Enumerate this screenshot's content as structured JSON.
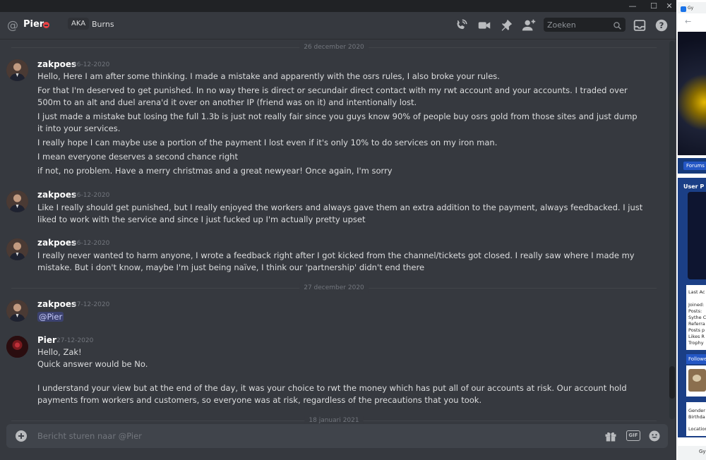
{
  "window": {
    "minimize": "—",
    "maximize": "☐",
    "close": "✕"
  },
  "header": {
    "at_symbol": "@",
    "dm_name": "Pier",
    "aka_label": "AKA",
    "alias": "Burns",
    "search_placeholder": "Zoeken"
  },
  "dividers": {
    "d1": "26 december 2020",
    "d2": "27 december 2020",
    "d3": "18 januari 2021"
  },
  "messages": [
    {
      "author": "zakpoes",
      "timestamp": "26-12-2020",
      "lines": [
        "Hello, Here I am after some thinking. I made a mistake and apparently with the osrs rules, I also broke your rules.",
        "For that I'm deserved to get punished. In no way there is direct or secundair direct contact with my rwt account and your accounts. I traded over 500m to an alt and duel arena'd it over on another IP (friend was on it) and intentionally lost.",
        "I just made a mistake but losing the full 1.3b is just not really fair since you guys know 90% of people buy osrs gold from those sites and just dump it into your services.",
        "I really hope I can maybe use a portion of the payment I lost even if it's only 10% to do services on my iron man.",
        "I mean everyone deserves a second chance right",
        "if not, no problem. Have a merry christmas and a great newyear! Once again, I'm sorry"
      ]
    },
    {
      "author": "zakpoes",
      "timestamp": "26-12-2020",
      "lines": [
        "Like I really should get punished, but I really enjoyed the workers and always gave them an extra addition to the payment, always feedbacked. I just liked to work with the service and since I just fucked up I'm actually pretty upset"
      ]
    },
    {
      "author": "zakpoes",
      "timestamp": "26-12-2020",
      "lines": [
        "I really never wanted to harm anyone, I wrote a feedback right after I got kicked from the channel/tickets got closed. I really saw where I made my mistake. But i don't know, maybe I'm just being naïve, I think our 'partnership' didn't end there"
      ]
    },
    {
      "author": "zakpoes",
      "timestamp": "27-12-2020",
      "lines": [
        "@Pier"
      ]
    },
    {
      "author": "Pier",
      "timestamp": "27-12-2020",
      "lines": [
        "Hello, Zak!",
        "Quick answer would be No.",
        "I understand your view but at the end of the day, it was your choice to rwt the money which has put all of our accounts at risk. Our account hold payments from workers and customers, so everyone was at risk, regardless of the precautions that you took."
      ]
    }
  ],
  "composer": {
    "placeholder": "Bericht sturen naar @Pier",
    "gif_label": "GIF"
  },
  "browser": {
    "tab_label": "Gy",
    "nav_button": "Forums",
    "panel_title": "User P",
    "info": [
      "Last Ac",
      "Joined:",
      "Posts:",
      "Sythe C",
      "Referra",
      "Posts p",
      "Likes R",
      "Trophy"
    ],
    "follow_label": "Followe",
    "info2": [
      "Gender",
      "Birthda",
      "Location"
    ],
    "bottom_tab": "Gy"
  },
  "colors": {
    "background": "#36393f",
    "dnd_status": "#ed4245",
    "mention": "#3c4270"
  }
}
